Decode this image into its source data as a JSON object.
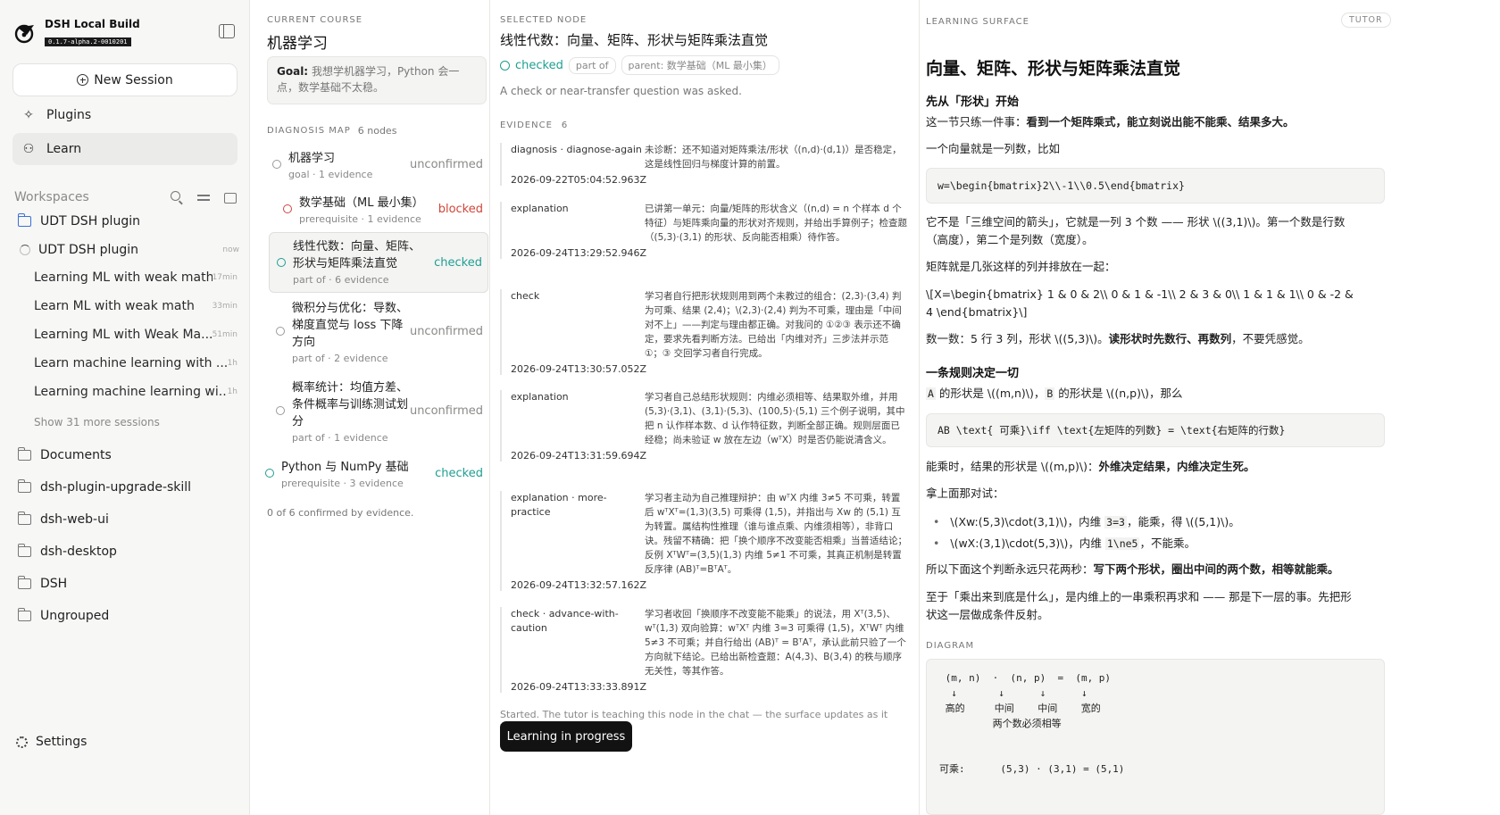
{
  "app": {
    "name": "DSH Local Build",
    "version": "0.1.7-alpha.2-0010201"
  },
  "sidebar": {
    "new_session": "New Session",
    "nav": [
      {
        "label": "Plugins",
        "icon": "puzzle-icon"
      },
      {
        "label": "Learn",
        "icon": "learn-graph-icon",
        "active": true
      }
    ],
    "workspaces_label": "Workspaces",
    "workspaces": [
      {
        "label": "UDT DSH plugin",
        "icon": "folder-open-icon"
      },
      {
        "label": "UDT DSH plugin",
        "icon": "spinner-icon",
        "time": "now"
      }
    ],
    "sessions": [
      {
        "label": "Learning ML with weak math",
        "time": "17min"
      },
      {
        "label": "Learn ML with weak math",
        "time": "33min"
      },
      {
        "label": "Learning ML with Weak Ma...",
        "time": "51min"
      },
      {
        "label": "Learn machine learning with ...",
        "time": "1h"
      },
      {
        "label": "Learning machine learning wi...",
        "time": "1h"
      }
    ],
    "show_more": "Show 31 more sessions",
    "folders": [
      "Documents",
      "dsh-plugin-upgrade-skill",
      "dsh-web-ui",
      "dsh-desktop",
      "DSH",
      "Ungrouped"
    ],
    "settings": "Settings"
  },
  "course": {
    "label": "CURRENT COURSE",
    "title": "机器学习",
    "goal_label": "Goal:",
    "goal_text": "我想学机器学习，Python 会一点，数学基础不太稳。",
    "diagnosis_label": "DIAGNOSIS MAP",
    "diagnosis_count": "6 nodes",
    "nodes": [
      {
        "name": "机器学习",
        "meta": "goal · 1 evidence",
        "status": "unconfirmed"
      },
      {
        "name": "数学基础（ML 最小集）",
        "meta": "prerequisite · 1 evidence",
        "status": "blocked"
      },
      {
        "name": "线性代数：向量、矩阵、形状与矩阵乘法直觉",
        "meta": "part of · 6 evidence",
        "status": "checked"
      },
      {
        "name": "微积分与优化：导数、梯度直觉与 loss 下降方向",
        "meta": "part of · 2 evidence",
        "status": "unconfirmed"
      },
      {
        "name": "概率统计：均值方差、条件概率与训练测试划分",
        "meta": "part of · 1 evidence",
        "status": "unconfirmed"
      },
      {
        "name": "Python 与 NumPy 基础",
        "meta": "prerequisite · 3 evidence",
        "status": "checked"
      }
    ],
    "footer": "0 of 6 confirmed by evidence."
  },
  "selected": {
    "label": "SELECTED NODE",
    "title": "线性代数：向量、矩阵、形状与矩阵乘法直觉",
    "status": "checked",
    "relation": "part of",
    "parent": "parent: 数学基础（ML 最小集）",
    "description": "A check or near-transfer question was asked.",
    "evidence_label": "EVIDENCE",
    "evidence_count": "6",
    "evidence": [
      {
        "type": "diagnosis · diagnose-again",
        "text": "未诊断：还不知道对矩阵乘法/形状（(n,d)·(d,1)）是否稳定，这是线性回归与梯度计算的前置。",
        "time": "2026-09-22T05:04:52.963Z"
      },
      {
        "type": "explanation",
        "text": "已讲第一单元：向量/矩阵的形状含义（(n,d) = n 个样本 d 个特征）与矩阵乘向量的形状对齐规则，并给出手算例子；检查题（(5,3)·(3,1) 的形状、反向能否相乘）待作答。",
        "time": "2026-09-24T13:29:52.946Z"
      },
      {
        "type": "check",
        "text": "学习者自行把形状规则用到两个未教过的组合：(2,3)·(3,4) 判为可乘、结果 (2,4)；\\(2,3)·(2,4) 判为不可乘，理由是「中间对不上」——判定与理由都正确。对我问的 ①②③ 表示还不确定，要求先看判断方法。已给出「内维对齐」三步法并示范 ①；③ 交回学习者自行完成。",
        "time": "2026-09-24T13:30:57.052Z"
      },
      {
        "type": "explanation",
        "text": "学习者自己总结形状规则：内维必须相等、结果取外维，并用 (5,3)·(3,1)、(3,1)·(5,3)、(100,5)·(5,1) 三个例子说明，其中把 n 认作样本数、d 认作特征数，判断全部正确。规则层面已经稳；尚未验证 w 放在左边（wᵀX）时是否仍能说清含义。",
        "time": "2026-09-24T13:31:59.694Z"
      },
      {
        "type": "explanation · more-practice",
        "text": "学习者主动为自己推理辩护：由 wᵀX 内维 3≠5 不可乘，转置后 wᵀXᵀ=(1,3)(3,5) 可乘得 (1,5)，并指出与 Xw 的 (5,1) 互为转置。属结构性推理（谁与谁点乘、内维须相等），非背口诀。残留不精确：把「换个顺序不改变能否相乘」当普适结论；反例 XᵀWᵀ=(3,5)(1,3) 内维 5≠1 不可乘，其真正机制是转置反序律 (AB)ᵀ=BᵀAᵀ。",
        "time": "2026-09-24T13:32:57.162Z"
      },
      {
        "type": "check · advance-with-caution",
        "text": "学习者收回「换顺序不改变能不能乘」的说法，用 Xᵀ(3,5)、wᵀ(1,3) 双向验算：wᵀXᵀ 内维 3=3 可乘得 (1,5)，XᵀWᵀ 内维 5≠3 不可乘；并自行给出 (AB)ᵀ = BᵀAᵀ，承认此前只验了一个方向就下结论。已给出新检查题：A(4,3)、B(3,4) 的秩与顺序无关性，等其作答。",
        "time": "2026-09-24T13:33:33.891Z"
      }
    ],
    "footer": "Started. The tutor is teaching this node in the chat — the surface updates as it writes.",
    "button": "Learning in progress"
  },
  "surface": {
    "label": "LEARNING SURFACE",
    "tag": "TUTOR",
    "title": "向量、矩阵、形状与矩阵乘法直觉",
    "h1": "先从「形状」开始",
    "p1_plain": "这一节只练一件事：",
    "p1_bold": "看到一个矩阵乘式，能立刻说出能不能乘、结果多大。",
    "p2": "一个向量就是一列数，比如",
    "code1": "w=\\begin{bmatrix}2\\\\-1\\\\0.5\\end{bmatrix}",
    "p3": "它不是「三维空间的箭头」，它就是一列 3 个数 —— 形状 \\((3,1)\\)。第一个数是行数（高度），第二个是列数（宽度）。",
    "p4": "矩阵就是几张这样的列并排放在一起：",
    "p5": "\\[X=\\begin{bmatrix} 1 & 0 & 2\\\\ 0 & 1 & -1\\\\ 2 & 3 & 0\\\\ 1 & 1 & 1\\\\ 0 & -2 & 4 \\end{bmatrix}\\]",
    "p6_plain": "数一数：5 行 3 列，形状 \\((5,3)\\)。",
    "p6_bold": "读形状时先数行、再数列",
    "p6_tail": "，不要凭感觉。",
    "h2": "一条规则决定一切",
    "p7_a": "A",
    "p7_b": " 的形状是 \\((m,n)\\)，",
    "p7_c": "B",
    "p7_d": " 的形状是 \\((n,p)\\)，那么",
    "code2": "AB \\text{ 可乘}\\iff \\text{左矩阵的列数} = \\text{右矩阵的行数}",
    "p8_plain": "能乘时，结果的形状是 \\((m,p)\\)：",
    "p8_bold": "外维决定结果，内维决定生死。",
    "p9": "拿上面那对试：",
    "b1_a": "\\(Xw:(5,3)\\cdot(3,1)\\)，内维 ",
    "b1_code": "3=3",
    "b1_b": "，能乘，得 \\((5,1)\\)。",
    "b2_a": "\\(wX:(3,1)\\cdot(5,3)\\)，内维 ",
    "b2_code": "1\\ne5",
    "b2_b": "，不能乘。",
    "p10_plain": "所以下面这个判断永远只花两秒：",
    "p10_bold": "写下两个形状，圈出中间的两个数，相等就能乘。",
    "p11": "至于「乘出来到底是什么」，是内维上的一串乘积再求和 —— 那是下一层的事。先把形状这一层做成条件反射。",
    "diagram_label": "DIAGRAM",
    "diagram": " (m, n)  ·  (n, p)  =  (m, p)\n  ↓       ↓      ↓      ↓\n 高的     中间    中间    宽的\n         两个数必须相等\n\n\n可乘:      (5,3) · (3,1) = (5,1)"
  }
}
